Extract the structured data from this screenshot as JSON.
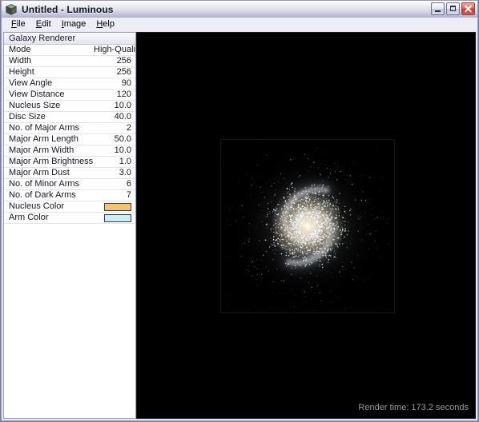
{
  "window": {
    "title": "Untitled - Luminous",
    "icon": "cube-icon",
    "frame_color": "#7a7e9d",
    "titlebar_buttons": [
      {
        "name": "minimize-button",
        "label": "Minimize",
        "glyph": "minimize-icon"
      },
      {
        "name": "maximize-button",
        "label": "Maximize",
        "glyph": "maximize-icon"
      },
      {
        "name": "close-button",
        "label": "Close",
        "glyph": "close-icon",
        "color": "#c9382a"
      }
    ]
  },
  "menubar": {
    "items": [
      {
        "label": "File",
        "accel": "F"
      },
      {
        "label": "Edit",
        "accel": "E"
      },
      {
        "label": "Image",
        "accel": "I"
      },
      {
        "label": "Help",
        "accel": "H"
      }
    ]
  },
  "property_panel": {
    "group_title": "Galaxy Renderer",
    "rows": [
      {
        "name": "Mode",
        "value": "High-Quality",
        "type": "text"
      },
      {
        "name": "Width",
        "value": "256",
        "type": "text"
      },
      {
        "name": "Height",
        "value": "256",
        "type": "text"
      },
      {
        "name": "View Angle",
        "value": "90",
        "type": "text"
      },
      {
        "name": "View Distance",
        "value": "120",
        "type": "text"
      },
      {
        "name": "Nucleus Size",
        "value": "10.0",
        "type": "text"
      },
      {
        "name": "Disc Size",
        "value": "40.0",
        "type": "text"
      },
      {
        "name": "No. of Major Arms",
        "value": "2",
        "type": "text"
      },
      {
        "name": "Major Arm Length",
        "value": "50.0",
        "type": "text"
      },
      {
        "name": "Major Arm Width",
        "value": "10.0",
        "type": "text"
      },
      {
        "name": "Major Arm Brightness",
        "value": "1.0",
        "type": "text"
      },
      {
        "name": "Major Arm Dust",
        "value": "3.0",
        "type": "text"
      },
      {
        "name": "No. of Minor Arms",
        "value": "6",
        "type": "text"
      },
      {
        "name": "No. of Dark Arms",
        "value": "7",
        "type": "text"
      },
      {
        "name": "Nucleus Color",
        "value": "#f5c271",
        "type": "color"
      },
      {
        "name": "Arm Color",
        "value": "#cdeef7",
        "type": "color"
      }
    ]
  },
  "canvas": {
    "background": "#000000",
    "render_status": "Render time: 173.2 seconds",
    "image_alt": "spiral-galaxy-render",
    "image_size": "256 x 256"
  }
}
